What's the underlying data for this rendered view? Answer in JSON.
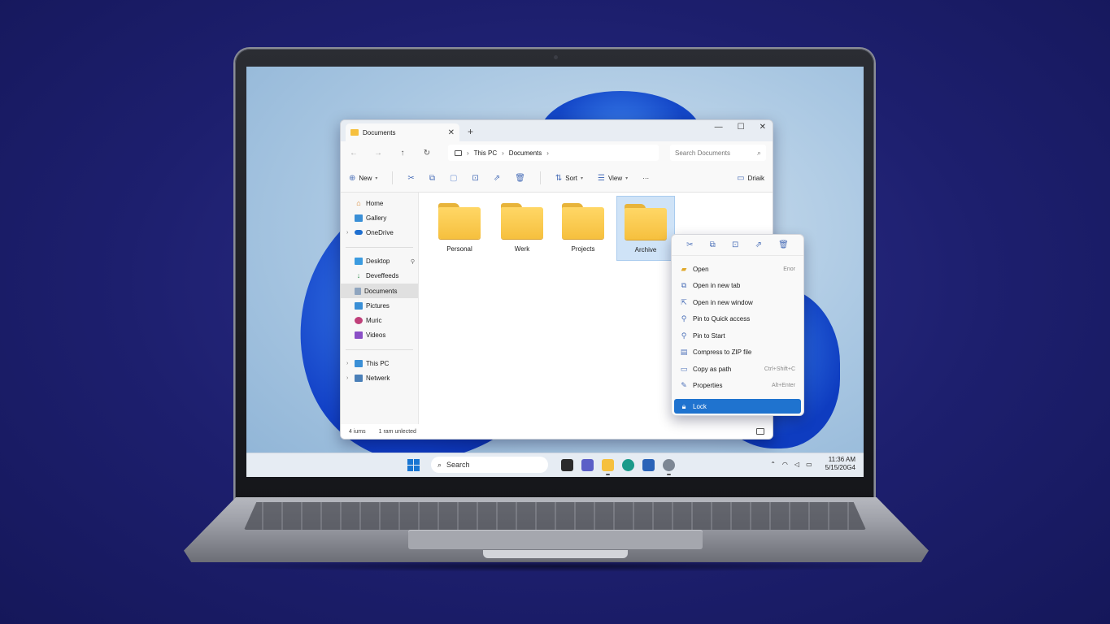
{
  "explorer": {
    "tab_title": "Documents",
    "tab_close": "✕",
    "new_tab": "+",
    "window_controls": {
      "minimize": "—",
      "maximize": "☐",
      "close": "✕"
    },
    "nav": {
      "back": "←",
      "forward": "→",
      "up": "↑",
      "refresh": "↻"
    },
    "breadcrumb": [
      "This PC",
      "Documents"
    ],
    "search_placeholder": "Search Documents",
    "toolbar": {
      "new_label": "New",
      "sort_label": "Sort",
      "view_label": "View",
      "more": "···",
      "details_label": "Driaik"
    },
    "sidebar": {
      "group1": [
        {
          "label": "Home",
          "icon": "home-icon"
        },
        {
          "label": "Gallery",
          "icon": "gallery-icon"
        },
        {
          "label": "OneDrive",
          "icon": "cloud-icon"
        }
      ],
      "group2": [
        {
          "label": "Desktop",
          "icon": "desktop-icon"
        },
        {
          "label": "Deveffeeds",
          "icon": "download-icon"
        },
        {
          "label": "Documents",
          "icon": "documents-icon"
        },
        {
          "label": "Pictures",
          "icon": "pictures-icon"
        },
        {
          "label": "Muric",
          "icon": "music-icon"
        },
        {
          "label": "Videos",
          "icon": "videos-icon"
        }
      ],
      "group3": [
        {
          "label": "This PC",
          "icon": "pc-icon"
        },
        {
          "label": "Netwerk",
          "icon": "network-icon"
        }
      ]
    },
    "folders": [
      "Personal",
      "Werk",
      "Projects",
      "Archive"
    ],
    "status": {
      "count": "4 iums",
      "selection": "1 ram unlected"
    }
  },
  "context_menu": {
    "quick_actions": [
      "cut-icon",
      "copy-icon",
      "rename-icon",
      "share-icon",
      "delete-icon"
    ],
    "items": [
      {
        "label": "Open",
        "shortcut": "Enor",
        "icon": "open-icon"
      },
      {
        "label": "Open in new tab",
        "shortcut": "",
        "icon": "new-tab-icon"
      },
      {
        "label": "Open in new window",
        "shortcut": "",
        "icon": "new-window-icon"
      },
      {
        "label": "Pin to Quick access",
        "shortcut": "",
        "icon": "pin-icon"
      },
      {
        "label": "Pin to Start",
        "shortcut": "",
        "icon": "pin-start-icon"
      },
      {
        "label": "Compress to ZIP file",
        "shortcut": "",
        "icon": "zip-icon"
      },
      {
        "label": "Copy as path",
        "shortcut": "Ctrl+Shift+C",
        "icon": "path-icon"
      },
      {
        "label": "Properties",
        "shortcut": "Alt+Enter",
        "icon": "properties-icon"
      }
    ],
    "highlighted": {
      "label": "Lock",
      "icon": "lock-icon"
    }
  },
  "taskbar": {
    "search_label": "Search",
    "time": "11:36 AM",
    "date": "5/15/20G4"
  },
  "colors": {
    "accent": "#1f73cf",
    "folder": "#f6c03e",
    "background": "#1d1f6e"
  }
}
